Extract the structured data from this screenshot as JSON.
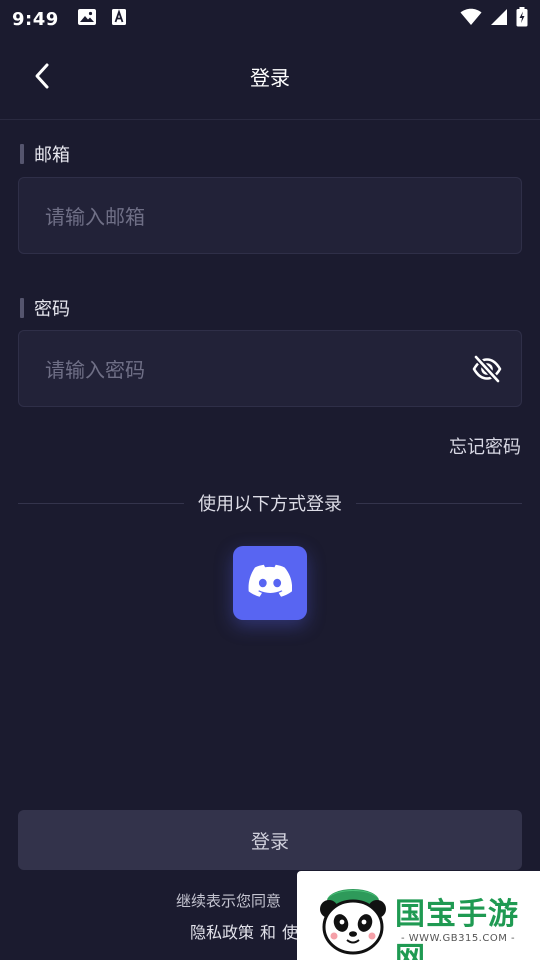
{
  "status_bar": {
    "time": "9:49"
  },
  "header": {
    "title": "登录"
  },
  "email": {
    "label": "邮箱",
    "placeholder": "请输入邮箱",
    "value": ""
  },
  "password": {
    "label": "密码",
    "placeholder": "请输入密码",
    "value": ""
  },
  "forgot_password": "忘记密码",
  "divider": {
    "text": "使用以下方式登录"
  },
  "login_button": "登录",
  "terms": {
    "line1": "继续表示您同意",
    "privacy": "隐私政策",
    "and": "和",
    "use": "使"
  },
  "watermark": {
    "brand": "国宝手游网",
    "url": "- WWW.GB315.COM -"
  },
  "colors": {
    "background": "#1b1b2f",
    "input_background": "#222238",
    "discord": "#5865f2",
    "login_button": "#33334b",
    "watermark_green": "#1f9a52"
  },
  "icons": {
    "back": "chevron-left-icon",
    "eye": "eye-off-icon",
    "discord": "discord-icon"
  }
}
